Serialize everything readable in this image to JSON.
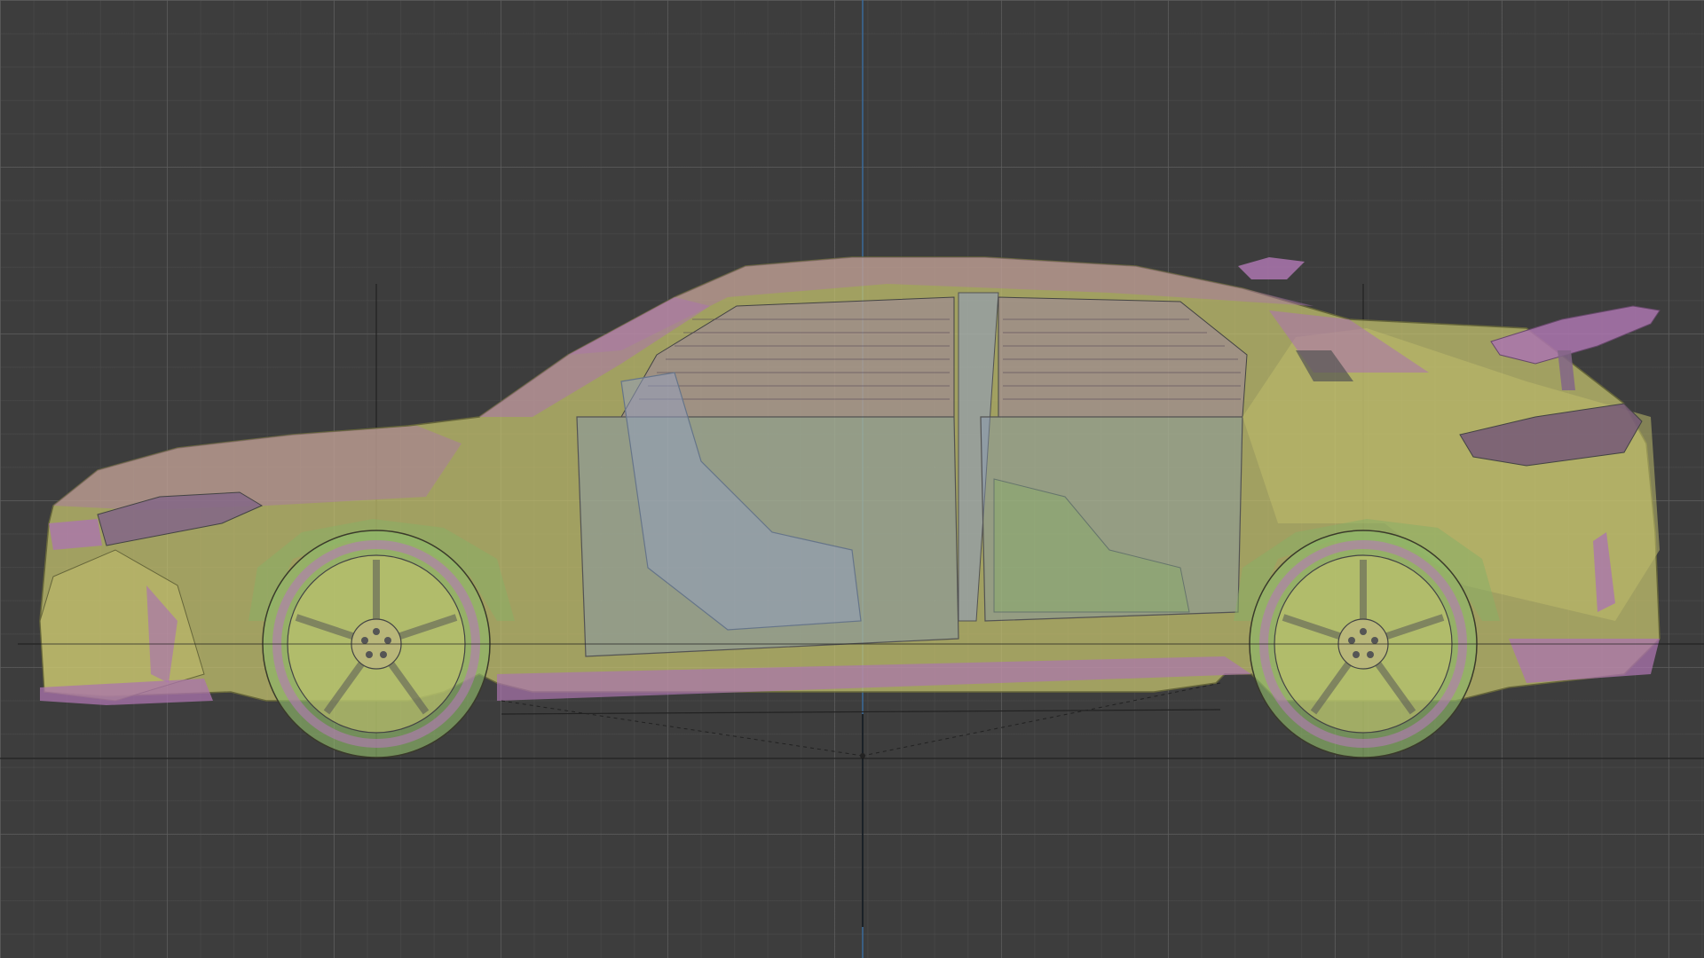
{
  "viewport": {
    "mode": "orthographic-side-view",
    "object": "hatchback-car-model",
    "display": "x-ray-transparent",
    "grid": true
  },
  "colors": {
    "background": "#3d3d3d",
    "grid_major": "#5f5f5f",
    "grid_minor": "#505050",
    "body_yellow": "#c9c76f",
    "body_purple": "#b57ab8",
    "body_green": "#8fb86a",
    "glass_blue": "#8aa0c0",
    "axis_line": "#202020",
    "axis_blue": "#3a6a9a"
  },
  "icons": {
    "object_origin": "origin-marker-icon"
  }
}
